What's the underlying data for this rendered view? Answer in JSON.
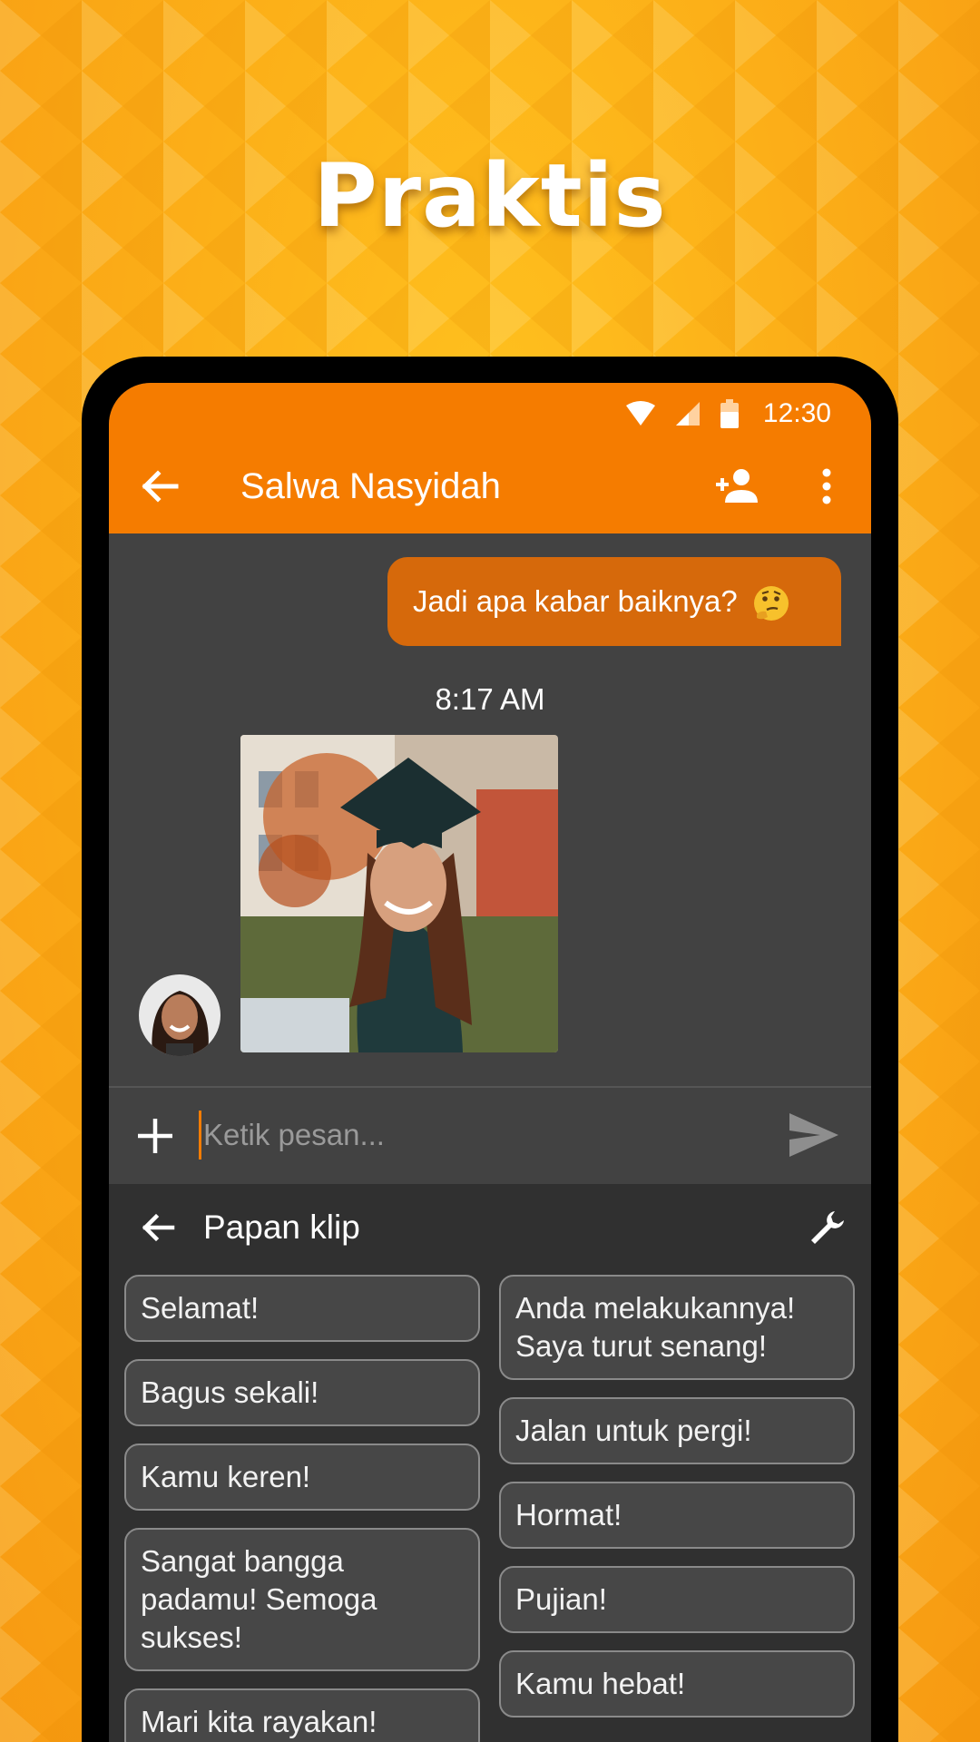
{
  "headline": "Praktis",
  "status": {
    "time": "12:30"
  },
  "toolbar": {
    "contact_name": "Salwa Nasyidah"
  },
  "conversation": {
    "outgoing_message": "Jadi apa kabar baiknya?",
    "outgoing_emoji": "thinking-face",
    "timestamp": "8:17 AM"
  },
  "compose": {
    "placeholder": "Ketik pesan..."
  },
  "clipboard": {
    "title": "Papan klip",
    "left_items": [
      "Selamat!",
      "Bagus sekali!",
      "Kamu keren!",
      "Sangat bangga padamu! Semoga sukses!",
      "Mari kita rayakan!"
    ],
    "right_items": [
      "Anda melakukannya! Saya turut senang!",
      "Jalan untuk pergi!",
      "Hormat!",
      "Pujian!",
      "Kamu hebat!"
    ]
  },
  "colors": {
    "accent": "#f57c00",
    "bubble": "#d6690b",
    "background": "#f9a81b",
    "screen": "#424242",
    "panel": "#303030"
  }
}
